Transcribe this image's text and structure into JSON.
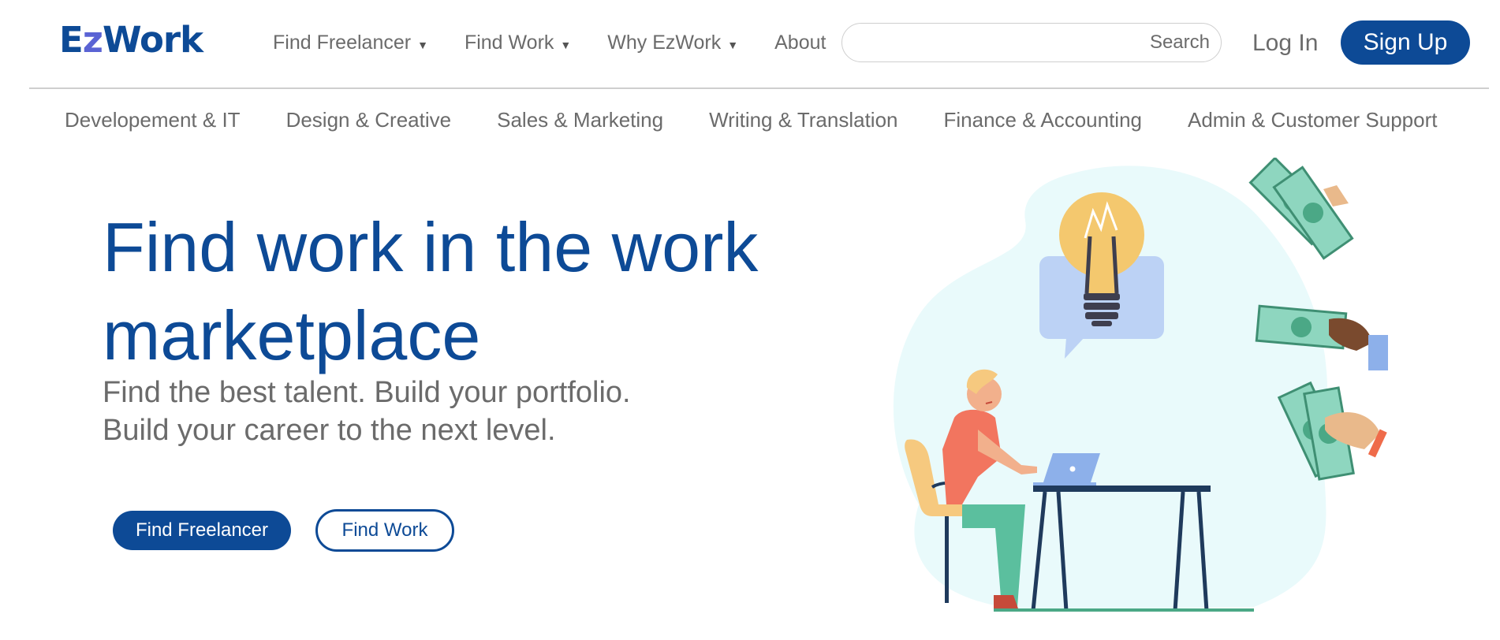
{
  "brand": {
    "logo_part1": "E",
    "logo_part2": "z",
    "logo_part3": "Work",
    "primary_color": "#0d4a96",
    "accent_color": "#5a63d4"
  },
  "nav": {
    "items": [
      {
        "label": "Find Freelancer",
        "has_dropdown": true
      },
      {
        "label": "Find Work",
        "has_dropdown": true
      },
      {
        "label": "Why EzWork",
        "has_dropdown": true
      },
      {
        "label": "About",
        "has_dropdown": false
      }
    ],
    "caret": "▼"
  },
  "search": {
    "label": "Search",
    "value": "",
    "placeholder": ""
  },
  "auth": {
    "login_label": "Log In",
    "signup_label": "Sign Up"
  },
  "categories": [
    "Developement & IT",
    "Design & Creative",
    "Sales & Marketing",
    "Writing & Translation",
    "Finance & Accounting",
    "Admin & Customer Support"
  ],
  "hero": {
    "title": "Find work in the work marketplace",
    "subtitle": "Find the best talent. Build your portfolio. Build your career to the next level.",
    "primary_button": "Find Freelancer",
    "secondary_button": "Find Work"
  },
  "illustration": {
    "icons": [
      "lightbulb-icon",
      "person-at-desk-illustration",
      "money-bill-icon"
    ],
    "blob_color": "#e9fafb",
    "money_color": "#8ed6bf",
    "bulb_color": "#f4c86e"
  }
}
